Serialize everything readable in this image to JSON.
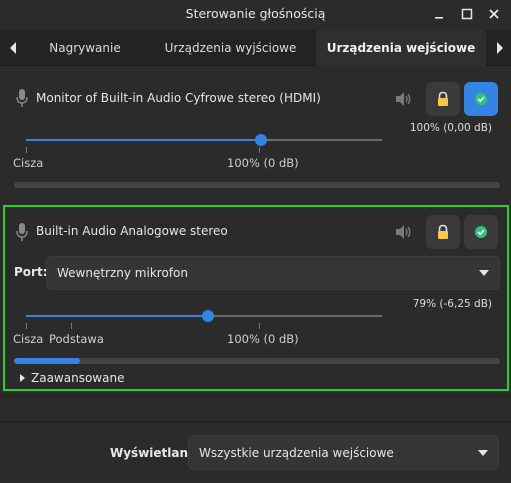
{
  "window": {
    "title": "Sterowanie głośnością",
    "icons": [
      "minimize-icon",
      "maximize-icon",
      "close-icon"
    ]
  },
  "tabs": [
    {
      "label": "Nagrywanie",
      "active": false
    },
    {
      "label": "Urządzenia wyjściowe",
      "active": false
    },
    {
      "label": "Urządzenia wejściowe",
      "active": true
    }
  ],
  "devices": [
    {
      "name": "Monitor of Built-in Audio Cyfrowe stereo (HDMI)",
      "volume_text": "100% (0,00 dB)",
      "volume_fraction": 0.66,
      "scale_left": "Cisza",
      "scale_mid": "100% (0 dB)",
      "level_fraction": 0.0,
      "locked": true,
      "default": true
    },
    {
      "name": "Built-in Audio Analogowe stereo",
      "port_label": "Port:",
      "port_value": "Wewnętrzny mikrofon",
      "volume_text": "79% (-6,25 dB)",
      "volume_fraction": 0.51,
      "scale_left": "Cisza",
      "scale_base": "Podstawa",
      "scale_mid": "100% (0 dB)",
      "level_fraction": 0.135,
      "locked": true,
      "default": true,
      "advanced_label": "Zaawansowane"
    }
  ],
  "footer": {
    "label": "Wyświetlanie:",
    "value": "Wszystkie urządzenia wejściowe"
  },
  "colors": {
    "accent": "#3584e4",
    "highlight_border": "#2bd22b",
    "lock": "#f6c94a",
    "check": "#2ec27e"
  }
}
